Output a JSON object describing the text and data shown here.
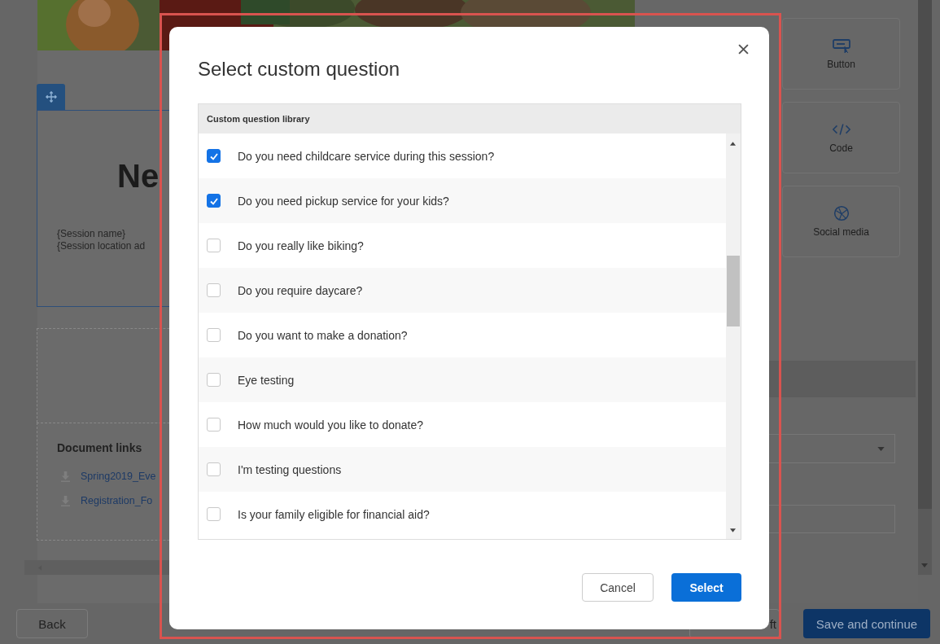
{
  "background": {
    "heading": "Ne",
    "session_lines": [
      "{Session name}",
      "{Session location ad"
    ],
    "document_links": {
      "title": "Document links",
      "links": [
        "Spring2019_Eve",
        "Registration_Fo"
      ]
    },
    "widgets": [
      {
        "label": "Button",
        "kind": "button"
      },
      {
        "label": "Code",
        "kind": "code"
      },
      {
        "label": "Social media",
        "kind": "social"
      }
    ],
    "footer": {
      "back": "Back",
      "save_draft": "ft",
      "save_continue": "Save and continue"
    }
  },
  "dialog": {
    "title": "Select custom question",
    "list_header": "Custom question library",
    "questions": [
      {
        "text": "Do you need childcare service during this session?",
        "checked": true
      },
      {
        "text": "Do you need pickup service for your kids?",
        "checked": true
      },
      {
        "text": "Do you really like biking?",
        "checked": false
      },
      {
        "text": "Do you require daycare?",
        "checked": false
      },
      {
        "text": "Do you want to make a donation?",
        "checked": false
      },
      {
        "text": "Eye testing",
        "checked": false
      },
      {
        "text": "How much would you like to donate?",
        "checked": false
      },
      {
        "text": "I'm testing questions",
        "checked": false
      },
      {
        "text": "Is your family eligible for financial aid?",
        "checked": false
      }
    ],
    "buttons": {
      "cancel": "Cancel",
      "select": "Select"
    }
  }
}
